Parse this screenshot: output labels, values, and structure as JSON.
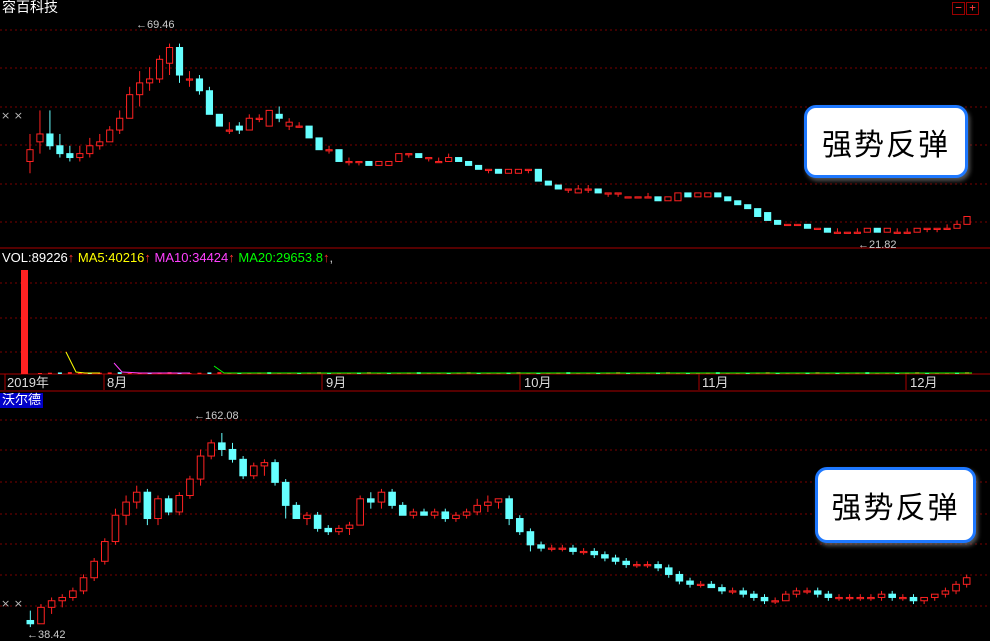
{
  "chart_data": [
    {
      "type": "candlestick",
      "title": "容百科技",
      "callout": "强势反弹",
      "max_label": "69.46",
      "min_label": "21.82",
      "ylim": [
        18,
        75
      ],
      "ohlc": [
        [
          39,
          46,
          36,
          42
        ],
        [
          44,
          52,
          41,
          46
        ],
        [
          46,
          52,
          42,
          43
        ],
        [
          43,
          46,
          40,
          41
        ],
        [
          41,
          43,
          39,
          40
        ],
        [
          40,
          43,
          39,
          41
        ],
        [
          41,
          45,
          40,
          43
        ],
        [
          43,
          46,
          42,
          44
        ],
        [
          44,
          48,
          44,
          47
        ],
        [
          47,
          52,
          46,
          50
        ],
        [
          50,
          58,
          50,
          56
        ],
        [
          56,
          62,
          53,
          59
        ],
        [
          59,
          63,
          57,
          60
        ],
        [
          60,
          66,
          59,
          65
        ],
        [
          64,
          69,
          61,
          68
        ],
        [
          68,
          69,
          59,
          61
        ],
        [
          60,
          62,
          58,
          60
        ],
        [
          60,
          61,
          56,
          57
        ],
        [
          57,
          58,
          51,
          51
        ],
        [
          51,
          51,
          48,
          48
        ],
        [
          47,
          49,
          46,
          47
        ],
        [
          48,
          49,
          46,
          47
        ],
        [
          47,
          51,
          47,
          50
        ],
        [
          50,
          51,
          49,
          50
        ],
        [
          48,
          52,
          48,
          52
        ],
        [
          51,
          53,
          49,
          50
        ],
        [
          48,
          50,
          47,
          49
        ],
        [
          48,
          49,
          48,
          48
        ],
        [
          48,
          48,
          45,
          45
        ],
        [
          45,
          45,
          42,
          42
        ],
        [
          42,
          43,
          41,
          42
        ],
        [
          42,
          42,
          39,
          39
        ],
        [
          39,
          40,
          38,
          39
        ],
        [
          39,
          39,
          38,
          39
        ],
        [
          39,
          39,
          38,
          38
        ],
        [
          38,
          39,
          38,
          39
        ],
        [
          38,
          39,
          38,
          39
        ],
        [
          39,
          41,
          39,
          41
        ],
        [
          41,
          41,
          40,
          41
        ],
        [
          41,
          41,
          40,
          40
        ],
        [
          40,
          40,
          39,
          40
        ],
        [
          39,
          40,
          39,
          39
        ],
        [
          39,
          41,
          39,
          40
        ],
        [
          40,
          40,
          39,
          39
        ],
        [
          39,
          39,
          38,
          38
        ],
        [
          38,
          38,
          37,
          37
        ],
        [
          37,
          37,
          36,
          37
        ],
        [
          37,
          37,
          36,
          36
        ],
        [
          36,
          37,
          36,
          37
        ],
        [
          36,
          37,
          36,
          37
        ],
        [
          37,
          37,
          36,
          37
        ],
        [
          37,
          37,
          34,
          34
        ],
        [
          34,
          34,
          33,
          33
        ],
        [
          33,
          33,
          32,
          32
        ],
        [
          32,
          32,
          31,
          32
        ],
        [
          31,
          33,
          31,
          32
        ],
        [
          32,
          33,
          31,
          32
        ],
        [
          32,
          32,
          31,
          31
        ],
        [
          31,
          31,
          30,
          31
        ],
        [
          31,
          31,
          30,
          31
        ],
        [
          30,
          30,
          30,
          30
        ],
        [
          30,
          30,
          30,
          30
        ],
        [
          30,
          31,
          30,
          30
        ],
        [
          30,
          30,
          29,
          29
        ],
        [
          29,
          30,
          29,
          30
        ],
        [
          29,
          31,
          29,
          31
        ],
        [
          31,
          31,
          30,
          30
        ],
        [
          30,
          31,
          30,
          31
        ],
        [
          30,
          31,
          30,
          31
        ],
        [
          31,
          31,
          30,
          30
        ],
        [
          30,
          30,
          29,
          29
        ],
        [
          29,
          29,
          28,
          28
        ],
        [
          28,
          28,
          27,
          27
        ],
        [
          27,
          27,
          25,
          25
        ],
        [
          26,
          26,
          24,
          24
        ],
        [
          24,
          24,
          23,
          23
        ],
        [
          23,
          23,
          23,
          23
        ],
        [
          23,
          23,
          23,
          23
        ],
        [
          23,
          23,
          22,
          22
        ],
        [
          22,
          22,
          22,
          22
        ],
        [
          22,
          22,
          21,
          21
        ],
        [
          21,
          22,
          21,
          21
        ],
        [
          21,
          21,
          21,
          21
        ],
        [
          21,
          22,
          21,
          21
        ],
        [
          21,
          22,
          21,
          22
        ],
        [
          22,
          22,
          21,
          21
        ],
        [
          21,
          22,
          21,
          22
        ],
        [
          21,
          22,
          21,
          21
        ],
        [
          21,
          22,
          21,
          21
        ],
        [
          21,
          22,
          21,
          22
        ],
        [
          22,
          22,
          21,
          22
        ],
        [
          22,
          22,
          21,
          22
        ],
        [
          22,
          23,
          22,
          22
        ],
        [
          22,
          24,
          22,
          23
        ],
        [
          23,
          25,
          23,
          25
        ]
      ]
    },
    {
      "type": "bar",
      "title": "VOL",
      "legend": [
        {
          "text": "VOL:",
          "value": "89226",
          "color": "#ffffff"
        },
        {
          "text": "MA5:",
          "value": "40216",
          "color": "#ffff00"
        },
        {
          "text": "MA10:",
          "value": "34424",
          "color": "#ff40ff"
        },
        {
          "text": "MA20:",
          "value": "29653.8",
          "color": "#00ff00"
        }
      ],
      "arrow": "↑",
      "x_labels": [
        "2019年",
        "8月",
        "9月",
        "10月",
        "11月",
        "12月"
      ],
      "volume_first": 89226
    },
    {
      "type": "candlestick",
      "title": "沃尔德",
      "callout": "强势反弹",
      "max_label": "162.08",
      "min_label": "38.42",
      "ylim": [
        35,
        170
      ],
      "ohlc": [
        [
          42,
          48,
          38,
          40
        ],
        [
          40,
          52,
          40,
          50
        ],
        [
          50,
          56,
          46,
          54
        ],
        [
          54,
          58,
          50,
          56
        ],
        [
          56,
          62,
          54,
          60
        ],
        [
          60,
          70,
          58,
          68
        ],
        [
          68,
          80,
          66,
          78
        ],
        [
          78,
          92,
          76,
          90
        ],
        [
          90,
          110,
          88,
          106
        ],
        [
          106,
          118,
          100,
          114
        ],
        [
          114,
          124,
          110,
          120
        ],
        [
          120,
          122,
          100,
          104
        ],
        [
          104,
          118,
          100,
          116
        ],
        [
          116,
          118,
          106,
          108
        ],
        [
          108,
          120,
          106,
          118
        ],
        [
          118,
          130,
          116,
          128
        ],
        [
          128,
          146,
          124,
          142
        ],
        [
          142,
          152,
          140,
          150
        ],
        [
          150,
          156,
          142,
          146
        ],
        [
          146,
          150,
          138,
          140
        ],
        [
          140,
          142,
          128,
          130
        ],
        [
          130,
          138,
          128,
          136
        ],
        [
          136,
          140,
          130,
          138
        ],
        [
          138,
          140,
          124,
          126
        ],
        [
          126,
          128,
          104,
          112
        ],
        [
          112,
          114,
          104,
          104
        ],
        [
          104,
          108,
          100,
          106
        ],
        [
          106,
          108,
          96,
          98
        ],
        [
          98,
          100,
          94,
          96
        ],
        [
          96,
          100,
          94,
          98
        ],
        [
          98,
          102,
          94,
          100
        ],
        [
          100,
          118,
          100,
          116
        ],
        [
          116,
          120,
          110,
          114
        ],
        [
          114,
          122,
          110,
          120
        ],
        [
          120,
          122,
          110,
          112
        ],
        [
          112,
          114,
          106,
          106
        ],
        [
          106,
          110,
          104,
          108
        ],
        [
          108,
          110,
          106,
          106
        ],
        [
          106,
          110,
          104,
          108
        ],
        [
          108,
          110,
          102,
          104
        ],
        [
          104,
          108,
          102,
          106
        ],
        [
          106,
          110,
          104,
          108
        ],
        [
          108,
          116,
          106,
          112
        ],
        [
          112,
          118,
          108,
          114
        ],
        [
          114,
          116,
          110,
          116
        ],
        [
          116,
          118,
          100,
          104
        ],
        [
          104,
          106,
          94,
          96
        ],
        [
          96,
          98,
          84,
          88
        ],
        [
          88,
          90,
          84,
          86
        ],
        [
          86,
          88,
          84,
          86
        ],
        [
          86,
          88,
          84,
          86
        ],
        [
          86,
          88,
          82,
          84
        ],
        [
          84,
          86,
          82,
          84
        ],
        [
          84,
          86,
          80,
          82
        ],
        [
          82,
          84,
          78,
          80
        ],
        [
          80,
          82,
          76,
          78
        ],
        [
          78,
          80,
          74,
          76
        ],
        [
          76,
          78,
          74,
          76
        ],
        [
          76,
          78,
          74,
          76
        ],
        [
          76,
          78,
          72,
          74
        ],
        [
          74,
          76,
          68,
          70
        ],
        [
          70,
          72,
          64,
          66
        ],
        [
          66,
          68,
          62,
          64
        ],
        [
          64,
          66,
          62,
          64
        ],
        [
          64,
          66,
          62,
          62
        ],
        [
          62,
          64,
          58,
          60
        ],
        [
          60,
          62,
          58,
          60
        ],
        [
          60,
          62,
          56,
          58
        ],
        [
          58,
          60,
          54,
          56
        ],
        [
          56,
          58,
          52,
          54
        ],
        [
          54,
          56,
          52,
          54
        ],
        [
          54,
          60,
          54,
          58
        ],
        [
          58,
          62,
          56,
          60
        ],
        [
          60,
          62,
          58,
          60
        ],
        [
          60,
          62,
          56,
          58
        ],
        [
          58,
          60,
          54,
          56
        ],
        [
          56,
          58,
          54,
          56
        ],
        [
          56,
          58,
          54,
          56
        ],
        [
          56,
          58,
          54,
          56
        ],
        [
          56,
          58,
          54,
          56
        ],
        [
          56,
          60,
          54,
          58
        ],
        [
          58,
          60,
          54,
          56
        ],
        [
          56,
          58,
          54,
          56
        ],
        [
          56,
          58,
          52,
          54
        ],
        [
          54,
          56,
          52,
          56
        ],
        [
          56,
          58,
          54,
          58
        ],
        [
          58,
          62,
          56,
          60
        ],
        [
          60,
          66,
          58,
          64
        ],
        [
          64,
          70,
          62,
          68
        ]
      ]
    }
  ]
}
